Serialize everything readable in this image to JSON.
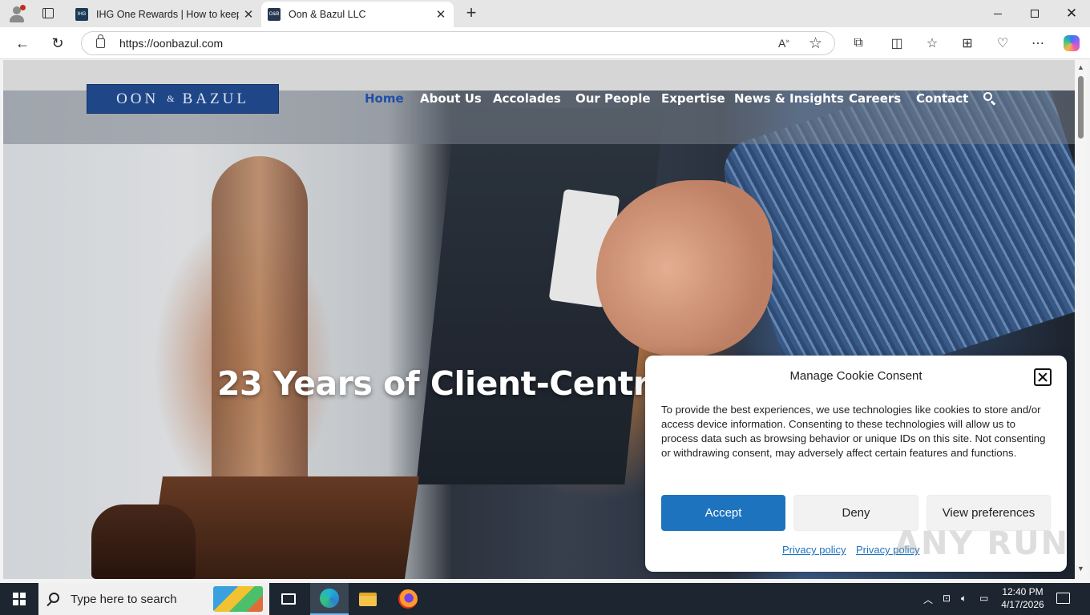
{
  "browser": {
    "tabs": [
      {
        "title": "IHG One Rewards | How to keep y",
        "favicon_text": "IHG",
        "active": false
      },
      {
        "title": "Oon & Bazul LLC",
        "favicon_text": "O&B",
        "active": true
      }
    ],
    "url": "https://oonbazul.com"
  },
  "site": {
    "logo_left": "OON",
    "logo_amp": "&",
    "logo_right": "BAZUL",
    "nav": [
      "Home",
      "About Us",
      "Accolades",
      "Our People",
      "Expertise",
      "News & Insights",
      "Careers",
      "Contact"
    ],
    "active_nav": "Home",
    "hero_title": "23 Years of Client-Centric",
    "colors": {
      "brand_blue": "#1f4788",
      "accent_blue": "#1e73be"
    }
  },
  "cookie": {
    "title": "Manage Cookie Consent",
    "body": "To provide the best experiences, we use technologies like cookies to store and/or access device information. Consenting to these technologies will allow us to process data such as browsing behavior or unique IDs on this site. Not consenting or withdrawing consent, may adversely affect certain features and functions.",
    "accept": "Accept",
    "deny": "Deny",
    "preferences": "View preferences",
    "links": [
      "Privacy policy",
      "Privacy policy"
    ]
  },
  "watermark": "ANY RUN",
  "taskbar": {
    "search_placeholder": "Type here to search",
    "time": "12:40 PM",
    "date": "4/17/2026"
  }
}
